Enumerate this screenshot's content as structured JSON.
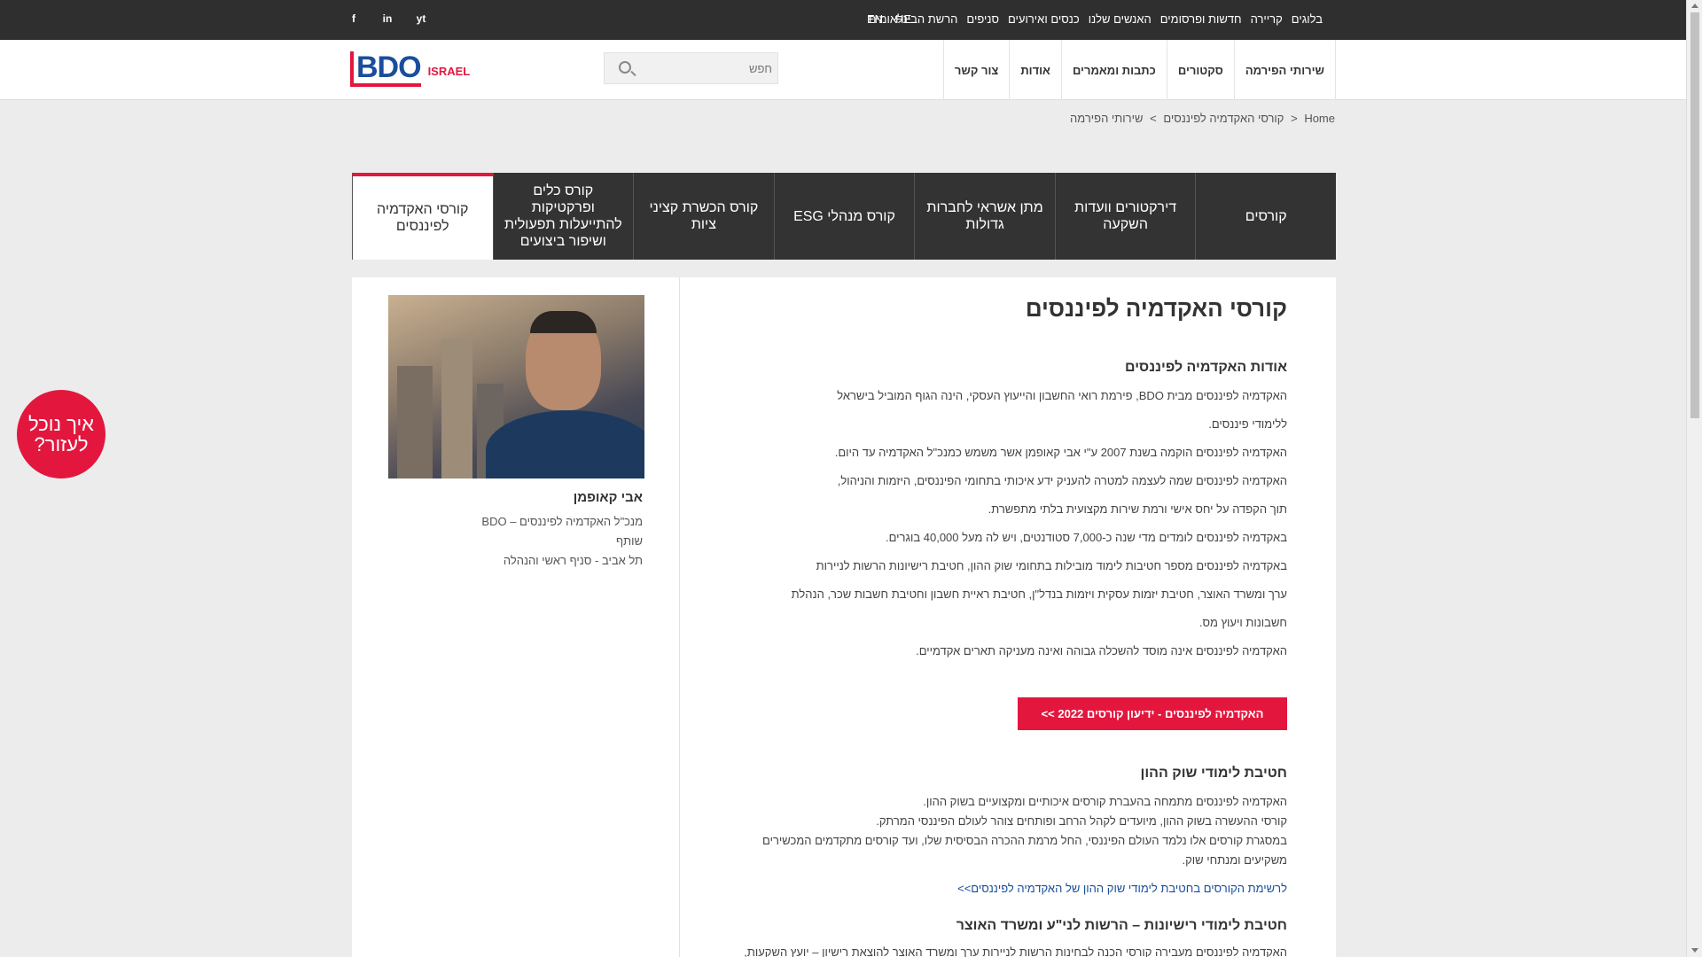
{
  "topbar": {
    "social": [
      "f",
      "in",
      "yt"
    ],
    "languages": [
      "EN",
      "HE"
    ],
    "links": [
      "הרשת הבינלאומית",
      "סניפים",
      "כנסים ואירועים",
      "האנשים שלנו",
      "חדשות ופרסומים",
      "קריירה",
      "בלוגים"
    ]
  },
  "header": {
    "logo_text": "BDO",
    "logo_country": "ISRAEL",
    "search_placeholder": "חפש",
    "nav": [
      "שירותי הפירמה",
      "סקטורים",
      "כתבות ומאמרים",
      "אודות",
      "צור קשר"
    ]
  },
  "breadcrumb": [
    "Home",
    ">",
    "שירותי הפירמה",
    ">",
    "קורסי האקדמיה לפיננסים"
  ],
  "tabs": [
    {
      "label": "קורסים",
      "active": false
    },
    {
      "label": "דירקטורים וועדות השקעה",
      "active": false
    },
    {
      "label": "מתן אשראי לחברות גדולות",
      "active": false
    },
    {
      "label": "קורס מנהלי ESG",
      "active": false
    },
    {
      "label": "קורס הכשרת קציני ציות",
      "active": false
    },
    {
      "label": "קורס כלים ופרקטיקות להתייעלות תפעולית ושיפור ביצועים",
      "active": false
    },
    {
      "label": "קורסי האקדמיה לפיננסים",
      "active": true
    }
  ],
  "sidebar": {
    "name": "אבי קאופמן",
    "lines": [
      "מנכ\"ל האקדמיה לפיננסים – BDO",
      "שותף",
      "תל אביב - סניף ראשי והנהלה"
    ]
  },
  "main": {
    "title": "קורסי האקדמיה לפיננסים",
    "about_heading": "אודות האקדמיה לפיננסים",
    "about_paragraphs": [
      "האקדמיה לפיננסים מבית BDO, פירמת רואי החשבון והייעוץ העסקי, הינה הגוף המוביל בישראל",
      "ללימודי פיננסים.",
      "האקדמיה לפיננסים הוקמה בשנת 2007 ע\"י אבי קאופמן אשר משמש כמנכ\"ל האקדמיה עד היום.",
      "האקדמיה לפיננסים שמה לעצמה למטרה להעניק ידע איכותי בתחומי הפיננסים, היזמות והניהול,",
      "תוך הקפדה על יחס אישי ורמת שירות מקצועית בלתי מתפשרת.",
      "באקדמיה לפיננסים לומדים מדי שנה כ-7,000 סטודנטים, ויש לה מעל 40,000 בוגרים.",
      "באקדמיה לפיננסים מספר חטיבות לימוד מובילות בתחומי שוק ההון, חטיבת רישיונות הרשות לניירות",
      "ערך ומשרד האוצר, חטיבת יזמות עסקית ויזמות בנדל\"ן, חטיבת ראיית חשבון וחטיבת חשבות שכר, הנהלת",
      "חשבונות ויעוץ מס.",
      "האקדמיה לפיננסים אינה מוסד להשכלה גבוהה ואינה מעניקה תארים אקדמיים."
    ],
    "cta_label": "האקדמיה לפיננסים - ידיעון קורסים 2022 >>",
    "capital_heading": "חטיבת לימודי שוק ההון",
    "capital_paragraphs": [
      "האקדמיה לפיננסים מתמחה בהעברת קורסים איכותיים ומקצועיים בשוק ההון.",
      "קורסי ההעשרה בשוק ההון, מיועדים לקהל הרחב ופותחים צוהר לעולם הפיננסי המרתק.",
      "במסגרת קורסים אלו נלמד העולם הפיננסי, החל מרמת ההכרה הבסיסית שלו, ועד קורסים מתקדמים המכשירים",
      "משקיעים ומנתחי שוק."
    ],
    "capital_link": "לרשימת הקורסים בחטיבת לימודי שוק ההון של האקדמיה לפיננסים>>",
    "license_heading": "חטיבת לימודי רישיונות – הרשות לני\"ע ומשרד האוצר",
    "license_paragraph": "האקדמיה לפיננסים מעבירה קורסי הכנה לבחינות הרשות לניירות ערך ומשרד האוצר להוצאת רישיון – יועץ השקעות,"
  },
  "help_button": "איך נוכל לעזור?"
}
